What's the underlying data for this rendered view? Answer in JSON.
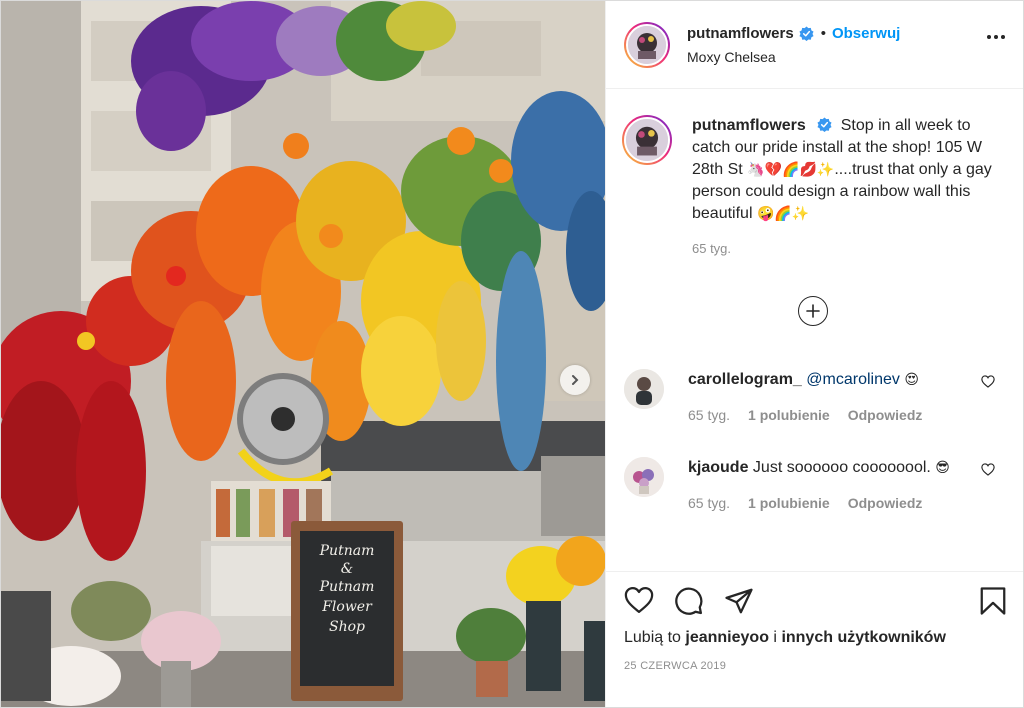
{
  "post": {
    "account": "putnamflowers",
    "follow_label": "Obserwuj",
    "dot": "•",
    "location": "Moxy Chelsea",
    "caption": {
      "text": "Stop in all week to catch our pride install at the shop! 105 W 28th St",
      "emojis_1": "🦄💔🌈💋✨",
      "text_2": "....trust that only a gay person could design a rainbow wall this beautiful",
      "emojis_2": "🤪🌈✨",
      "time": "65 tyg."
    },
    "chalkboard": {
      "line1": "Putnam",
      "line2": "&",
      "line3": "Putnam",
      "line4": "Flower",
      "line5": "Shop"
    },
    "comments": [
      {
        "user": "carollelogram_",
        "mention": "@mcarolinev",
        "text": "",
        "emoji": "😍",
        "time": "65 tyg.",
        "likes": "1 polubienie",
        "reply": "Odpowiedz"
      },
      {
        "user": "kjaoude",
        "mention": "",
        "text": "Just soooooo coooooool.",
        "emoji": "😎",
        "time": "65 tyg.",
        "likes": "1 polubienie",
        "reply": "Odpowiedz"
      }
    ],
    "likes": {
      "prefix": "Lubią to",
      "user": "jeannieyoo",
      "joiner": "i",
      "others": "innych użytkowników"
    },
    "date": "25 CZERWCA 2019"
  },
  "icons": {
    "verified": "verified-badge-icon",
    "more": "more-options-icon",
    "load_more": "plus-circle-icon",
    "like": "heart-icon",
    "comment": "comment-icon",
    "share": "paper-plane-icon",
    "save": "bookmark-icon",
    "next": "chevron-right-icon"
  },
  "colors": {
    "accent": "#0095f6",
    "verified": "#3897f0",
    "muted": "#8e8e8e",
    "text": "#262626"
  }
}
